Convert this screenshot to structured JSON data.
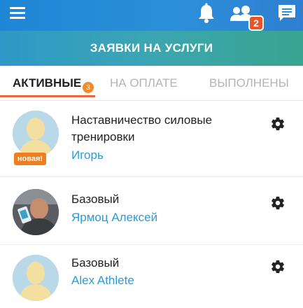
{
  "header": {
    "title": "ЗАЯВКИ НА УСЛУГИ",
    "people_badge": "2",
    "icons": [
      "menu-icon",
      "bell-icon",
      "people-icon",
      "message-icon"
    ]
  },
  "tabs": [
    {
      "label": "АКТИВНЫЕ",
      "badge": "3",
      "active": true
    },
    {
      "label": "НА ОПЛАТЕ",
      "active": false
    },
    {
      "label": "ВЫПОЛНЕНЫ",
      "active": false
    }
  ],
  "requests": [
    {
      "title_line1": "Наставничество силовые",
      "title_line2": "тренировки",
      "client": "Игорь",
      "new_label": "новая!"
    },
    {
      "title_line1": "Базовый",
      "client": "Ярмоц Алексей"
    },
    {
      "title_line1": "Базовый",
      "client": "Alex Athlete"
    }
  ],
  "colors": {
    "header_blue": "#1f86d6",
    "accent_orange": "#e8673f",
    "link_blue": "#2a9bd7"
  }
}
